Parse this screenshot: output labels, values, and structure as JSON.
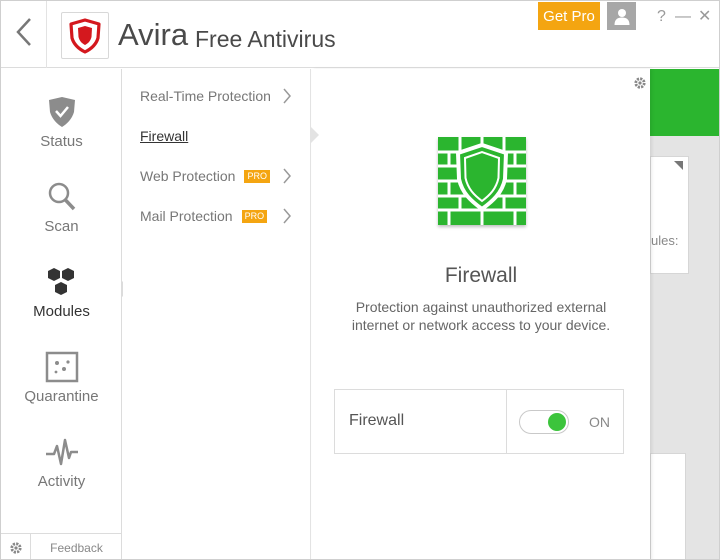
{
  "header": {
    "title": "Avira",
    "subtitle": "Free Antivirus",
    "get_pro_label": "Get Pro",
    "help_label": "?",
    "minimize_label": "—",
    "close_label": "✕"
  },
  "nav": {
    "items": [
      {
        "label": "Status",
        "icon": "shield-check-icon"
      },
      {
        "label": "Scan",
        "icon": "magnifier-icon"
      },
      {
        "label": "Modules",
        "icon": "hexagons-icon",
        "active": true
      },
      {
        "label": "Quarantine",
        "icon": "quarantine-box-icon"
      },
      {
        "label": "Activity",
        "icon": "pulse-icon"
      }
    ],
    "feedback_label": "Feedback"
  },
  "modules": {
    "items": [
      {
        "label": "Real-Time Protection",
        "pro": false
      },
      {
        "label": "Firewall",
        "pro": false,
        "active": true
      },
      {
        "label": "Web Protection",
        "pro": true,
        "pro_label": "PRO"
      },
      {
        "label": "Mail Protection",
        "pro": true,
        "pro_label": "PRO"
      }
    ]
  },
  "detail": {
    "title": "Firewall",
    "description": "Protection against unauthorized external internet or network access to your device.",
    "toggle_label": "Firewall",
    "toggle_state": "ON"
  },
  "background": {
    "card_text": "ules:"
  },
  "colors": {
    "accent_green": "#2bb52f",
    "pro_orange": "#f4a511",
    "logo_red": "#d4181e"
  }
}
